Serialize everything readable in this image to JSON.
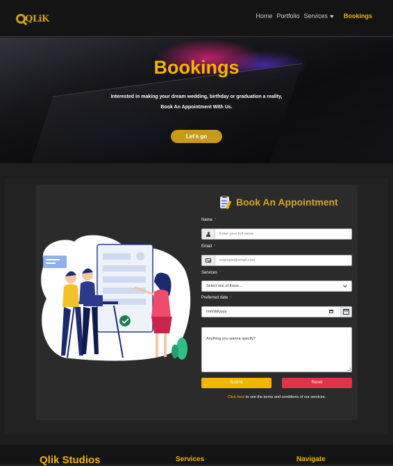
{
  "navbar": {
    "logo_text": "QLiK",
    "items": [
      "Home",
      "Portfolio",
      "Services"
    ],
    "active": "Bookings"
  },
  "hero": {
    "title": "Bookings",
    "line1": "Interested in making your dream wedding, birthday or graduation a reality,",
    "line2": "Book An Appointment With Us.",
    "cta": "Let's go"
  },
  "form": {
    "title": "Book An Appointment",
    "name_label": "Name",
    "name_placeholder": "Enter your full name",
    "email_label": "Email",
    "email_placeholder": "example@email.com",
    "services_label": "Services",
    "services_selected": "Select one of these...",
    "date_label": "Preferred date",
    "date_placeholder": "mm/dd/yyyy",
    "message_placeholder": "Anything you wanna specify?",
    "required_mark": "*",
    "submit": "Submit",
    "reset": "Reset",
    "terms_link": "Click here",
    "terms_text": " to see the terms and conditions of our services."
  },
  "footer": {
    "brand": "Qlik Studios",
    "col1": "Services",
    "col2": "Navigate"
  },
  "colors": {
    "accent": "#f4b400",
    "danger": "#dc3545",
    "background": "#1e1e1e"
  }
}
